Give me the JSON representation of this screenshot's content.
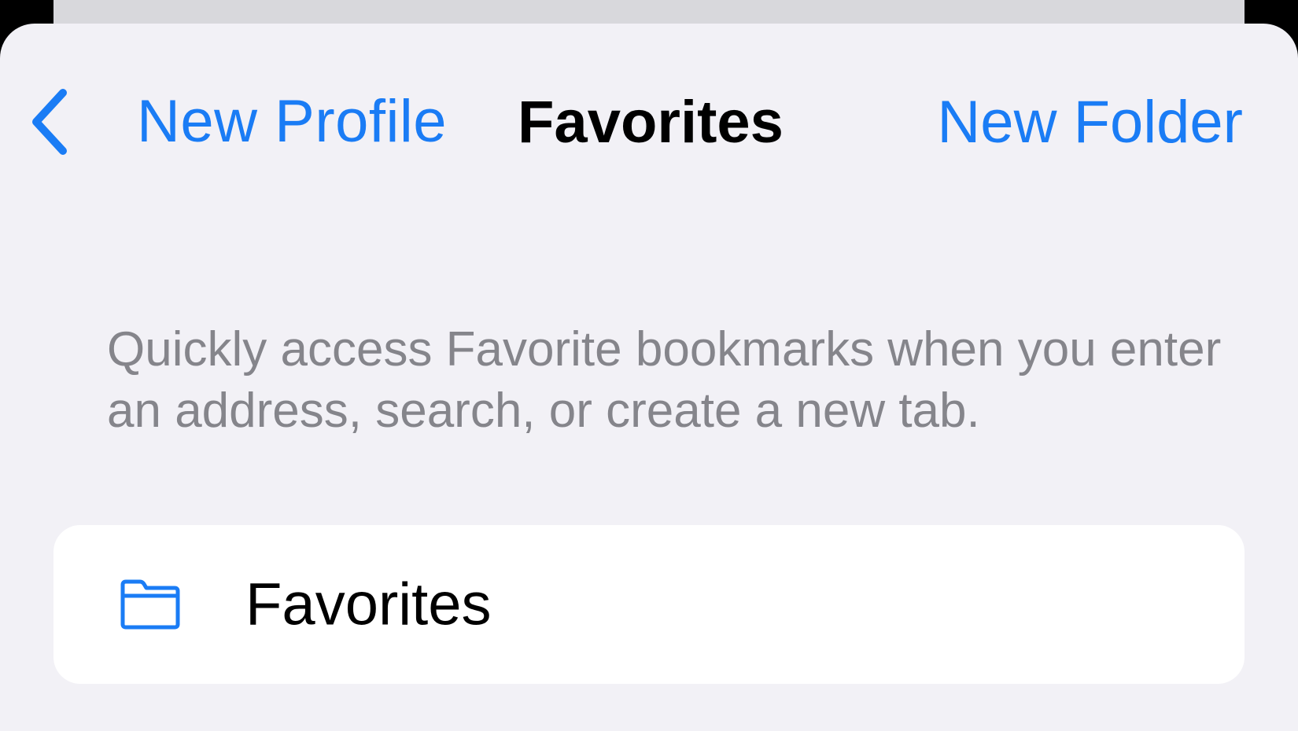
{
  "nav": {
    "back_label": "New Profile",
    "title": "Favorites",
    "action_label": "New Folder"
  },
  "description": "Quickly access Favorite bookmarks when you enter an address, search, or create a new tab.",
  "list": {
    "items": [
      {
        "icon": "folder-icon",
        "label": "Favorites"
      }
    ]
  },
  "colors": {
    "accent": "#1a7cf5",
    "background": "#f2f1f6",
    "card": "#ffffff",
    "secondary_text": "#85858b"
  }
}
